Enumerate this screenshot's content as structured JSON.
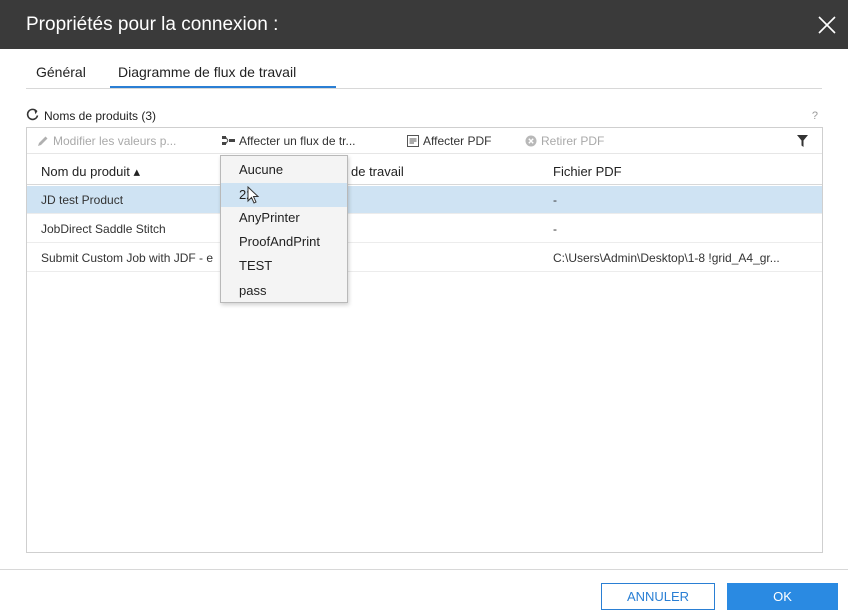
{
  "dialog": {
    "title": "Propriétés pour la connexion :",
    "close_icon": "close-icon"
  },
  "tabs": [
    {
      "label": "Général",
      "active": false
    },
    {
      "label": "Diagramme de flux de travail",
      "active": true
    }
  ],
  "section": {
    "refresh_icon": "refresh-icon",
    "label": "Noms de produits (3)",
    "help": "?"
  },
  "toolbar": {
    "edit_label": "Modifier les valeurs p...",
    "assign_flow_label": "Affecter un flux de tr...",
    "assign_pdf_label": "Affecter PDF",
    "remove_pdf_label": "Retirer PDF",
    "filter_icon": "filter-icon"
  },
  "table": {
    "columns": [
      "Nom du produit ▴",
      "de travail",
      "Fichier PDF"
    ],
    "rows": [
      {
        "name": "JD test Product",
        "workflow": "",
        "pdf": "-",
        "selected": true
      },
      {
        "name": "JobDirect Saddle Stitch",
        "workflow": "",
        "pdf": "-",
        "selected": false
      },
      {
        "name": "Submit Custom Job with JDF - e",
        "workflow": "",
        "pdf": "C:\\Users\\Admin\\Desktop\\1-8 !grid_A4_gr...",
        "selected": false
      }
    ]
  },
  "dropdown": {
    "options": [
      "Aucune",
      "22",
      "AnyPrinter",
      "ProofAndPrint",
      "TEST",
      "pass"
    ],
    "hovered": "22"
  },
  "footer": {
    "cancel_label": "ANNULER",
    "ok_label": "OK"
  },
  "colors": {
    "accent": "#2a7fd4",
    "titlebar": "#3a3a3a",
    "selection": "#cfe3f3"
  }
}
